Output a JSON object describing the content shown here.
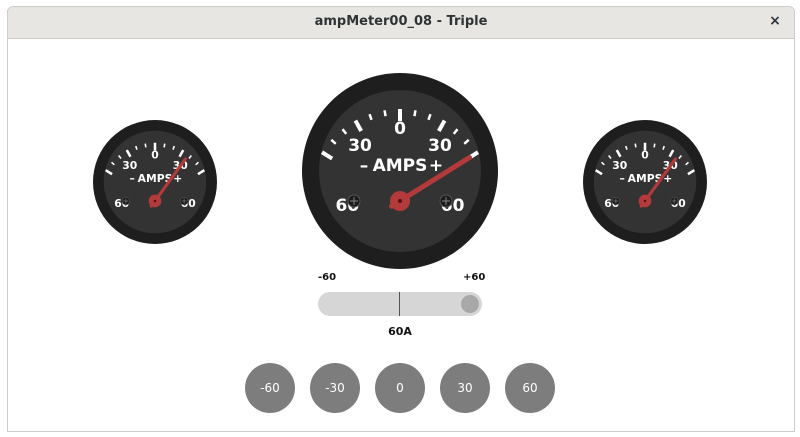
{
  "window": {
    "title": "ampMeter00_08 - Triple",
    "close_glyph": "×"
  },
  "gauges": [
    {
      "id": "left",
      "scale_labels": [
        "60",
        "30",
        "0",
        "30",
        "60"
      ],
      "unit_label": "AMPS",
      "minus": "–",
      "plus": "+",
      "value": 0.62
    },
    {
      "id": "center",
      "scale_labels": [
        "60",
        "30",
        "0",
        "30",
        "60"
      ],
      "unit_label": "AMPS",
      "minus": "–",
      "plus": "+",
      "value": 1.0
    },
    {
      "id": "right",
      "scale_labels": [
        "60",
        "30",
        "0",
        "30",
        "60"
      ],
      "unit_label": "AMPS",
      "minus": "–",
      "plus": "+",
      "value": 0.62
    }
  ],
  "slider": {
    "min_label": "-60",
    "max_label": "+60",
    "value_label": "60A",
    "value": 60,
    "min": -60,
    "max": 60
  },
  "buttons": [
    "-60",
    "-30",
    "0",
    "30",
    "60"
  ],
  "colors": {
    "bezel": "#1e1e1e",
    "face": "#333333",
    "needle": "#b23a3a",
    "button": "#7d7d7d"
  }
}
